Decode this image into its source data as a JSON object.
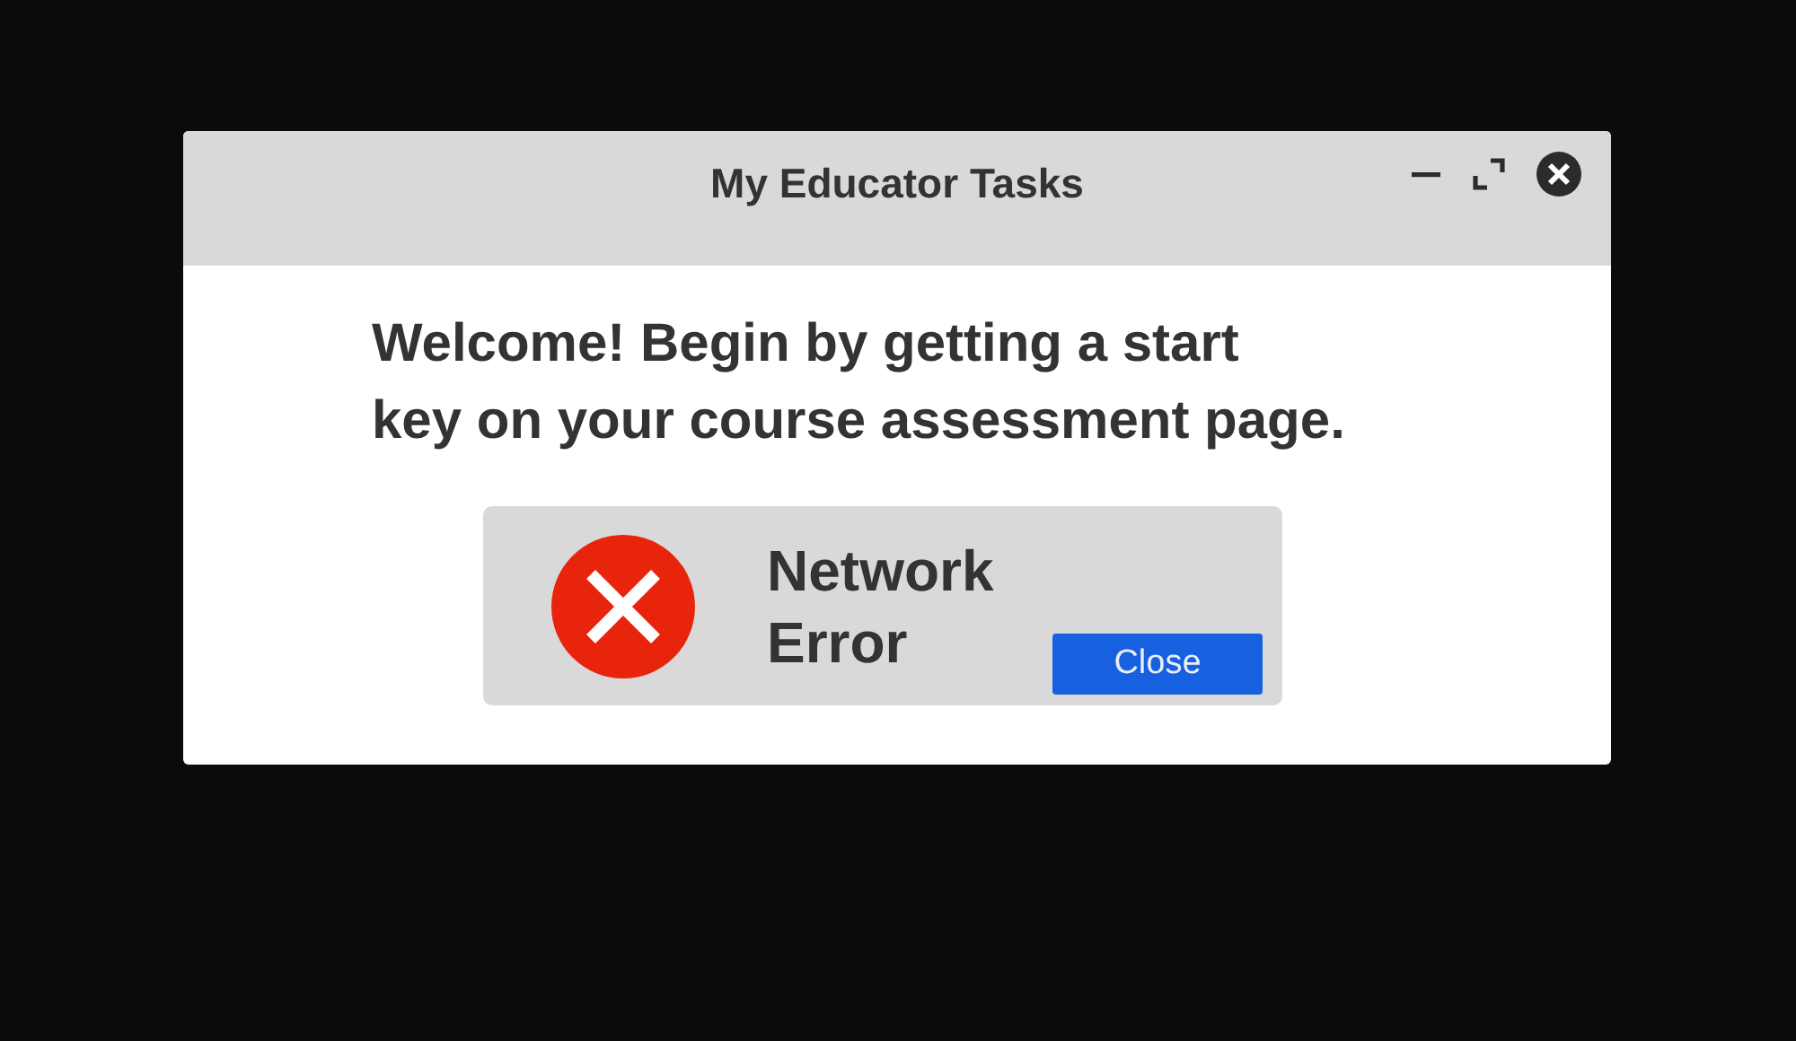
{
  "window": {
    "title": "My Educator Tasks"
  },
  "message": "Welcome! Begin by getting a start\nkey on your course assessment page.",
  "error": {
    "text": "Network Error",
    "button": "Close"
  }
}
